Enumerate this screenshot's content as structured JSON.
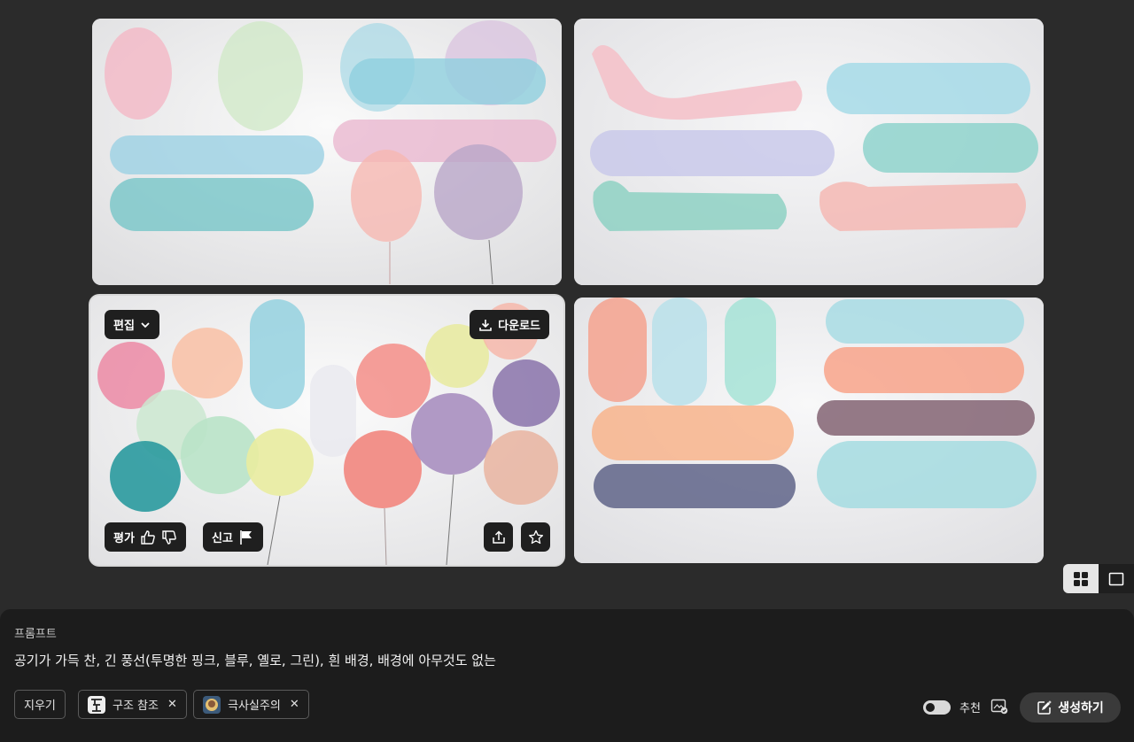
{
  "grid": {
    "selected_tile": 3,
    "tiles": [
      {
        "subject": "balloons-image-1"
      },
      {
        "subject": "balloons-image-2"
      },
      {
        "subject": "balloons-image-3"
      },
      {
        "subject": "balloons-image-4"
      }
    ],
    "overlay": {
      "edit_label": "편집",
      "download_label": "다운로드",
      "rate_label": "평가",
      "report_label": "신고"
    }
  },
  "view_toggle": {
    "active": "grid",
    "options": [
      "grid-view-icon",
      "single-view-icon"
    ]
  },
  "prompt_panel": {
    "label": "프롬프트",
    "prompt": "공기가 가득 찬, 긴 풍선(투명한 핑크, 블루, 옐로, 그린), 흰 배경, 배경에 아무것도 없는",
    "clear_label": "지우기",
    "tags": [
      {
        "label": "구조 참조"
      },
      {
        "label": "극사실주의"
      }
    ],
    "recommend_label": "추천",
    "recommend_on": true,
    "generate_label": "생성하기"
  },
  "colors": {
    "background": "#2b2b2b",
    "panel": "#1c1c1c",
    "chip": "#1f1f1f",
    "pink": "#f4b6c2",
    "blue": "#9fd6e4",
    "teal": "#4fb3b5",
    "yellow": "#e6e9a8",
    "green": "#c9e6c2",
    "peach": "#f7b49c",
    "lavender": "#a99ac0"
  }
}
